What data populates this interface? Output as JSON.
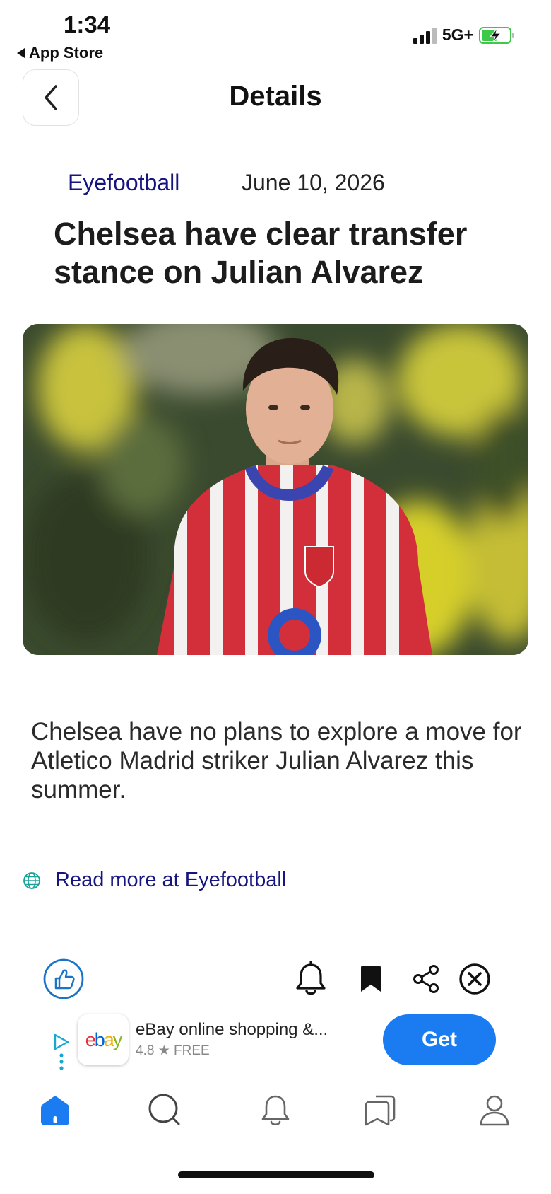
{
  "status_bar": {
    "time": "1:34",
    "back_app": "App Store",
    "network": "5G+",
    "battery_color": "#3cc94a"
  },
  "header": {
    "title": "Details",
    "back_icon": "chevron-left-icon"
  },
  "article": {
    "source": "Eyefootball",
    "date": "June 10, 2026",
    "headline": "Chelsea have clear transfer stance on Julian Alvarez",
    "image_icon": "footballer-photo",
    "summary": "Chelsea have no plans to explore a move for Atletico Madrid striker Julian Alvarez this summer.",
    "read_more": "Read more at Eyefootball"
  },
  "actions": {
    "icons": [
      "thumbs-up-icon",
      "bell-icon",
      "bookmark-icon",
      "share-icon",
      "close-icon"
    ],
    "accent": "#1a73c7"
  },
  "ad": {
    "app_title": "eBay online shopping &...",
    "rating": "4.8",
    "price": "FREE",
    "button_label": "Get",
    "button_color": "#1a7cf0",
    "logo_letters": [
      "e",
      "b",
      "a",
      "y"
    ],
    "logo_colors": [
      "#e53238",
      "#0064d2",
      "#f5af02",
      "#86b817"
    ]
  },
  "tab_bar": {
    "items": [
      "home-icon",
      "search-icon",
      "notifications-icon",
      "collections-icon",
      "profile-icon"
    ],
    "active_color": "#1a7cf0"
  }
}
